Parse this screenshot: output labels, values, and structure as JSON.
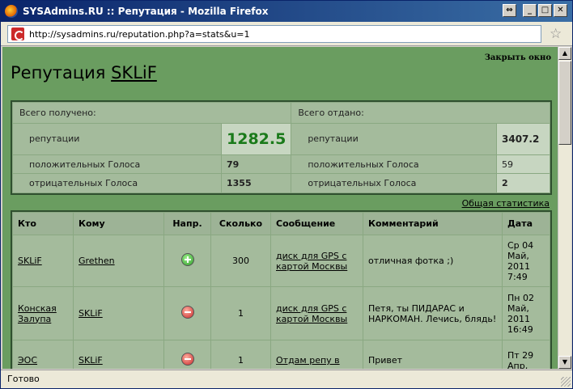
{
  "window": {
    "title": "SYSAdmins.RU :: Репутация - Mozilla Firefox",
    "buttons": {
      "restore_label": "⇔",
      "minimize_label": "_",
      "maximize_label": "□",
      "close_label": "✕"
    }
  },
  "urlbar": {
    "url": "http://sysadmins.ru/reputation.php?a=stats&u=1"
  },
  "page": {
    "close_link": "Закрыть окно",
    "heading_prefix": "Репутация ",
    "heading_user": "SKLiF",
    "stats_link": "Общая статистика"
  },
  "summary": {
    "received_header": "Всего получено:",
    "given_header": "Всего отдано:",
    "rows": [
      {
        "label": "репутации",
        "received": "1282.5",
        "given_label": "репутации",
        "given": "3407.2"
      },
      {
        "label": "положительных Голоса",
        "received": "79",
        "given_label": "положительных Голоса",
        "given": "59"
      },
      {
        "label": "отрицательных Голоса",
        "received": "1355",
        "given_label": "отрицательных Голоса",
        "given": "2"
      }
    ]
  },
  "table": {
    "headers": [
      "Кто",
      "Кому",
      "Напр.",
      "Сколько",
      "Сообщение",
      "Комментарий",
      "Дата"
    ],
    "rows": [
      {
        "who": "SKLiF",
        "to": "Grethen",
        "direction": "plus",
        "amount": "300",
        "message": "диск для GPS с картой Москвы",
        "comment": "отличная фотка ;)",
        "date": "Ср 04 Май, 2011 7:49"
      },
      {
        "who": "Конская Залупа",
        "to": "SKLiF",
        "direction": "minus",
        "amount": "1",
        "message": "диск для GPS с картой Москвы",
        "comment": "Петя, ты ПИДАРАС и НАРКОМАН. Лечись, блядь!",
        "date": "Пн 02 Май, 2011 16:49"
      },
      {
        "who": "ЭОС",
        "to": "SKLiF",
        "direction": "minus",
        "amount": "1",
        "message": "Отдам репу в",
        "comment": "Привет",
        "date": "Пт 29 Апр,"
      }
    ]
  },
  "status": {
    "text": "Готово"
  }
}
